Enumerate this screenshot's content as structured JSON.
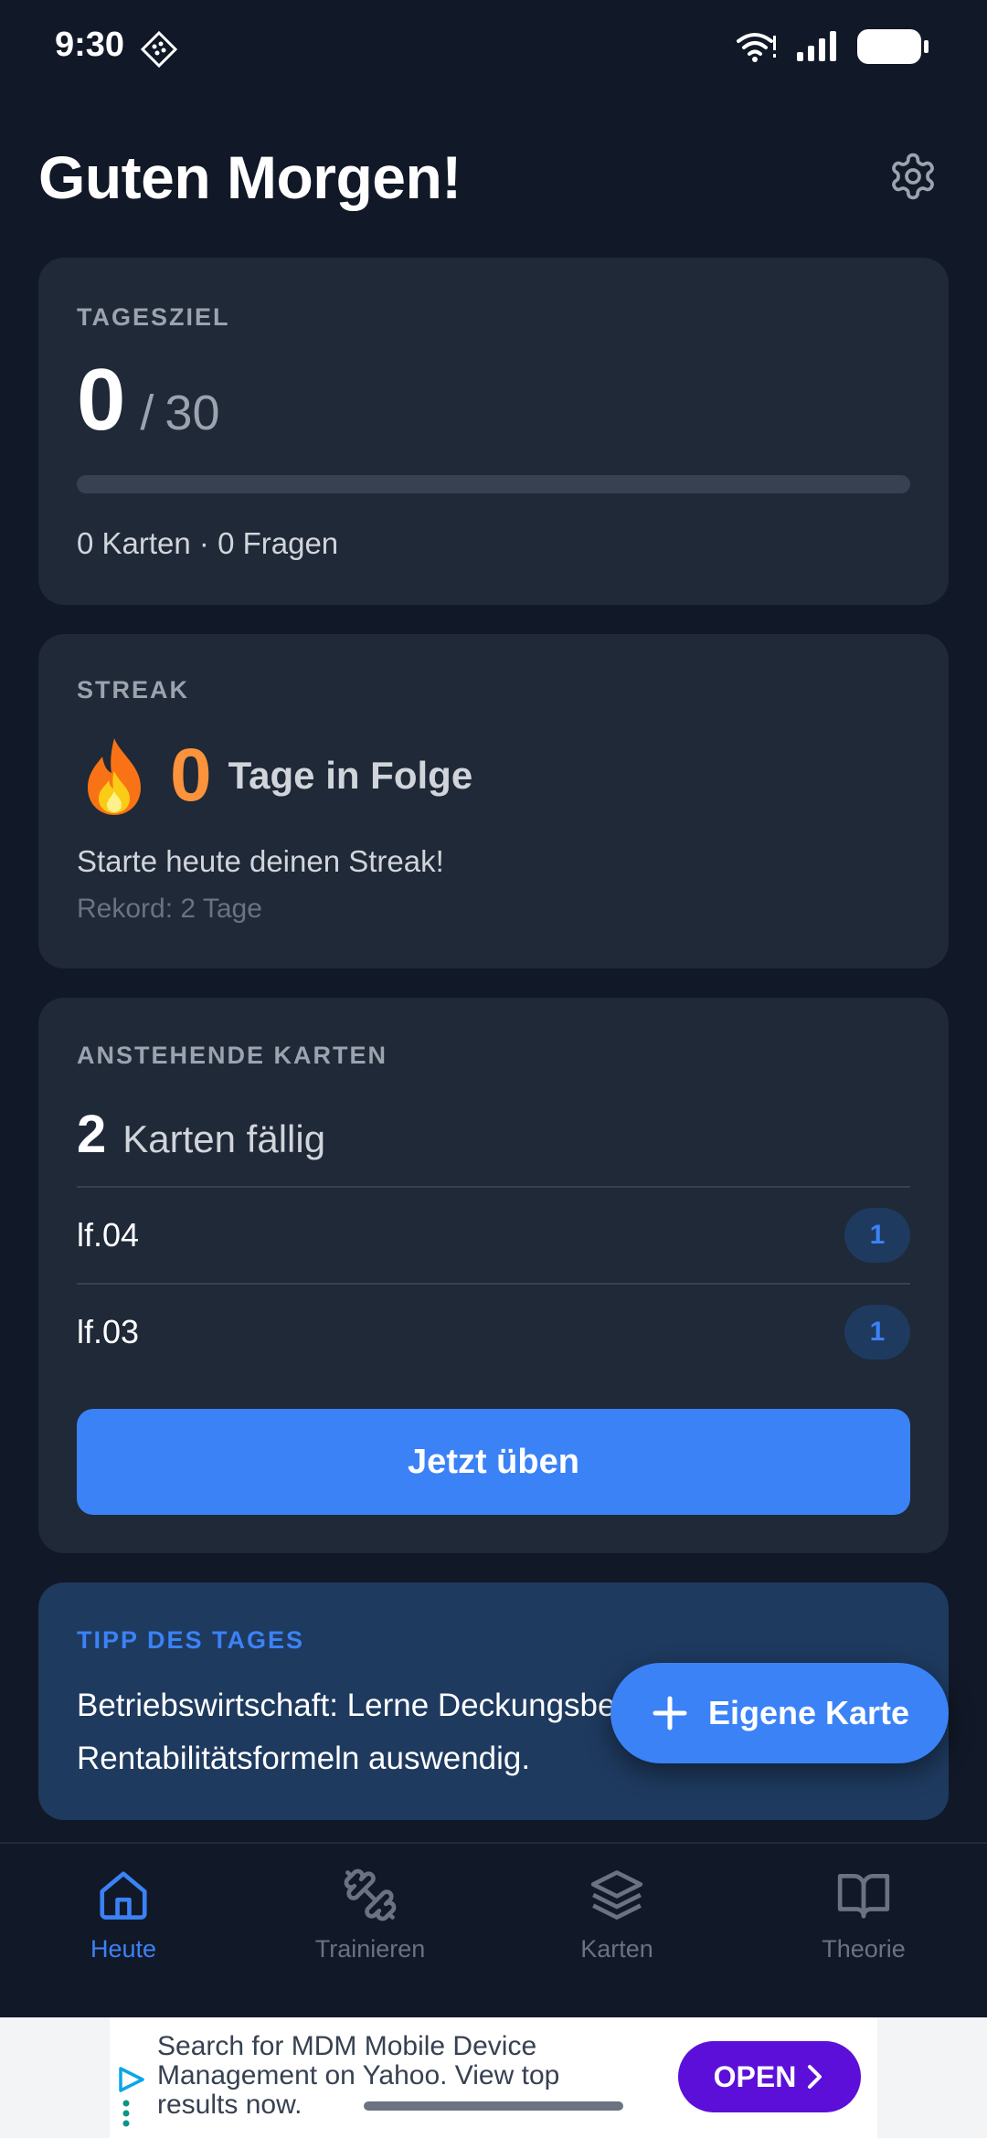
{
  "status": {
    "time": "9:30"
  },
  "header": {
    "title": "Guten Morgen!"
  },
  "goal": {
    "label": "TAGESZIEL",
    "value": "0",
    "separator": "/",
    "target": "30",
    "progress_fraction": 0,
    "stats": "0 Karten · 0 Fragen"
  },
  "streak": {
    "label": "STREAK",
    "value": "0",
    "unit": "Tage in Folge",
    "message": "Starte heute deinen Streak!",
    "record": "Rekord: 2 Tage"
  },
  "due": {
    "label": "ANSTEHENDE KARTEN",
    "count": "2",
    "text": "Karten fällig",
    "decks": [
      {
        "name": "lf.04",
        "count": "1"
      },
      {
        "name": "lf.03",
        "count": "1"
      }
    ],
    "button": "Jetzt üben"
  },
  "tip": {
    "label": "TIPP DES TAGES",
    "text": "Betriebswirtschaft: Lerne Deckungsbeitrags- und Rentabilitätsformeln auswendig."
  },
  "fab": {
    "label": "Eigene Karte"
  },
  "nav": {
    "items": [
      {
        "label": "Heute",
        "icon": "home-icon",
        "active": true
      },
      {
        "label": "Trainieren",
        "icon": "dumbbell-icon",
        "active": false
      },
      {
        "label": "Karten",
        "icon": "layers-icon",
        "active": false
      },
      {
        "label": "Theorie",
        "icon": "book-icon",
        "active": false
      }
    ]
  },
  "ad": {
    "text": "Search for MDM Mobile Device Management on Yahoo. View top results now.",
    "button": "OPEN"
  },
  "colors": {
    "background": "#111827",
    "card": "#1f2937",
    "accent": "#3b82f6",
    "streak": "#fb923c",
    "tip_card": "#1e3a5f",
    "ad_button": "#5b0fd8"
  }
}
